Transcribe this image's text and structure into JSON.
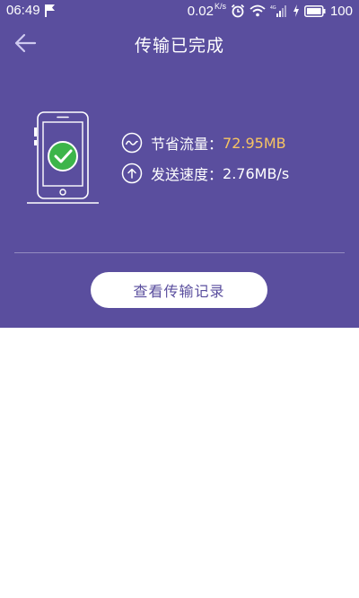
{
  "status_bar": {
    "time": "06:49",
    "net_speed": "0.02",
    "net_speed_unit": "K/s",
    "battery": "100"
  },
  "header": {
    "title": "传输已完成"
  },
  "stats": {
    "saved_label": "节省流量：",
    "saved_value": "72.95MB",
    "speed_label": "发送速度：",
    "speed_value": "2.76MB/s"
  },
  "actions": {
    "history_button_label": "查看传输记录"
  },
  "colors": {
    "background": "#5a4e9e",
    "accent_value": "#f7c462",
    "success_green": "#3cb54a"
  },
  "icons": [
    "flag-icon",
    "alarm-clock-icon",
    "wifi-icon",
    "signal-icon",
    "charging-icon",
    "battery-icon",
    "back-arrow-icon",
    "phone-check-icon",
    "traffic-wave-icon",
    "upload-icon"
  ]
}
